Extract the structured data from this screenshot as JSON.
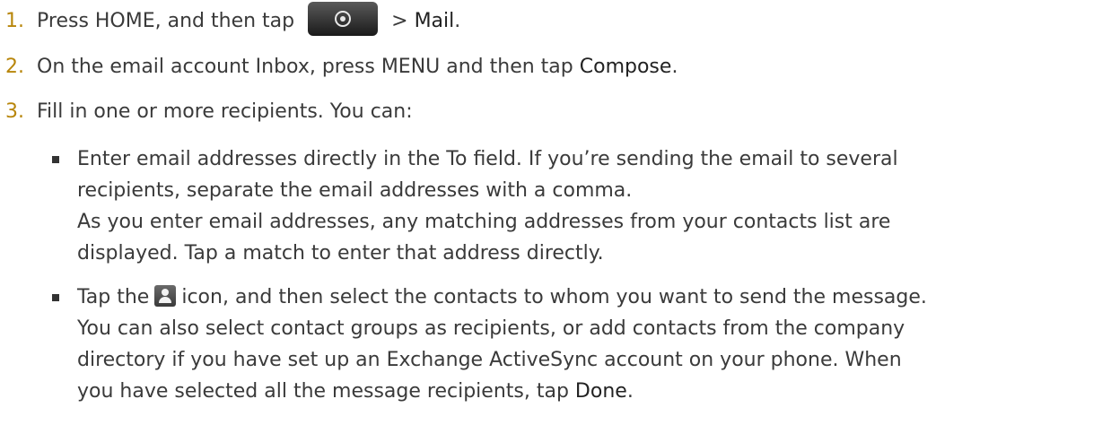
{
  "steps": [
    {
      "number": "1.",
      "text_before": "Press HOME, and then tap",
      "separator": ">",
      "bold": "Mail",
      "tail": "."
    },
    {
      "number": "2.",
      "text_before": "On the email account Inbox, press MENU and then tap",
      "bold": "Compose",
      "tail": "."
    },
    {
      "number": "3.",
      "text": "Fill in one or more recipients. You can:"
    }
  ],
  "bullets": [
    {
      "lines": [
        "Enter email addresses directly in the To field. If you’re sending the email to several",
        "recipients, separate the email addresses with a comma.",
        "As you enter email addresses, any matching addresses from your contacts list are",
        "displayed. Tap a match to enter that address directly."
      ]
    },
    {
      "line1_before": "Tap the",
      "line1_after": "icon, and then select the contacts to whom you want to send the message.",
      "lines": [
        "You can also select contact groups as recipients, or add contacts from the company",
        "directory if you have set up an Exchange ActiveSync account on your phone. When"
      ],
      "last_line_before": "you have selected all the message recipients, tap",
      "last_line_bold": "Done",
      "last_line_tail": "."
    }
  ],
  "icons": {
    "home_button": "all-apps-button-icon",
    "contacts": "contact-icon"
  }
}
